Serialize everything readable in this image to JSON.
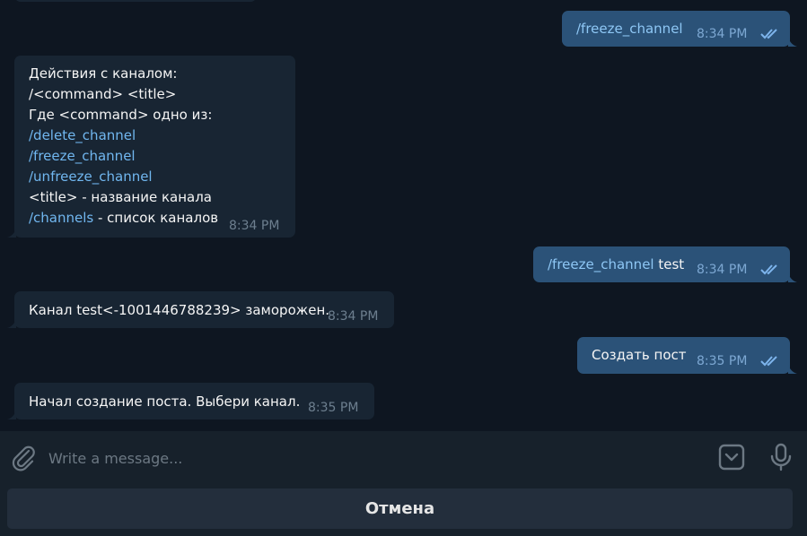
{
  "messages": {
    "m1": {
      "cmd": "/freeze_channel",
      "time": "8:34 PM"
    },
    "m2": {
      "l1": "Действия с каналом:",
      "l2": "/<command> <title>",
      "l3": "Где <command> одно из:",
      "l4": "/delete_channel",
      "l5": "/freeze_channel",
      "l6": "/unfreeze_channel",
      "l7": "<title> - название канала",
      "l8_cmd": "/channels",
      "l8_rest": " - список каналов",
      "time": "8:34 PM"
    },
    "m3": {
      "cmd": "/freeze_channel",
      "rest": " test",
      "time": "8:34 PM"
    },
    "m4": {
      "text": "Канал test<-1001446788239> заморожен.",
      "time": "8:34 PM"
    },
    "m5": {
      "text": "Создать пост",
      "time": "8:35 PM"
    },
    "m6": {
      "text": "Начал создание поста. Выбери канал.",
      "time": "8:35 PM"
    }
  },
  "composer": {
    "placeholder": "Write a message..."
  },
  "keyboard": {
    "button": "Отмена"
  },
  "colors": {
    "background": "#0e1621",
    "incoming": "#182533",
    "outgoing": "#2b5278",
    "link": "#71b7f0",
    "panel": "#17212b"
  },
  "icons": [
    "attach-icon",
    "sticker-icon",
    "microphone-icon",
    "double-check-icon"
  ]
}
